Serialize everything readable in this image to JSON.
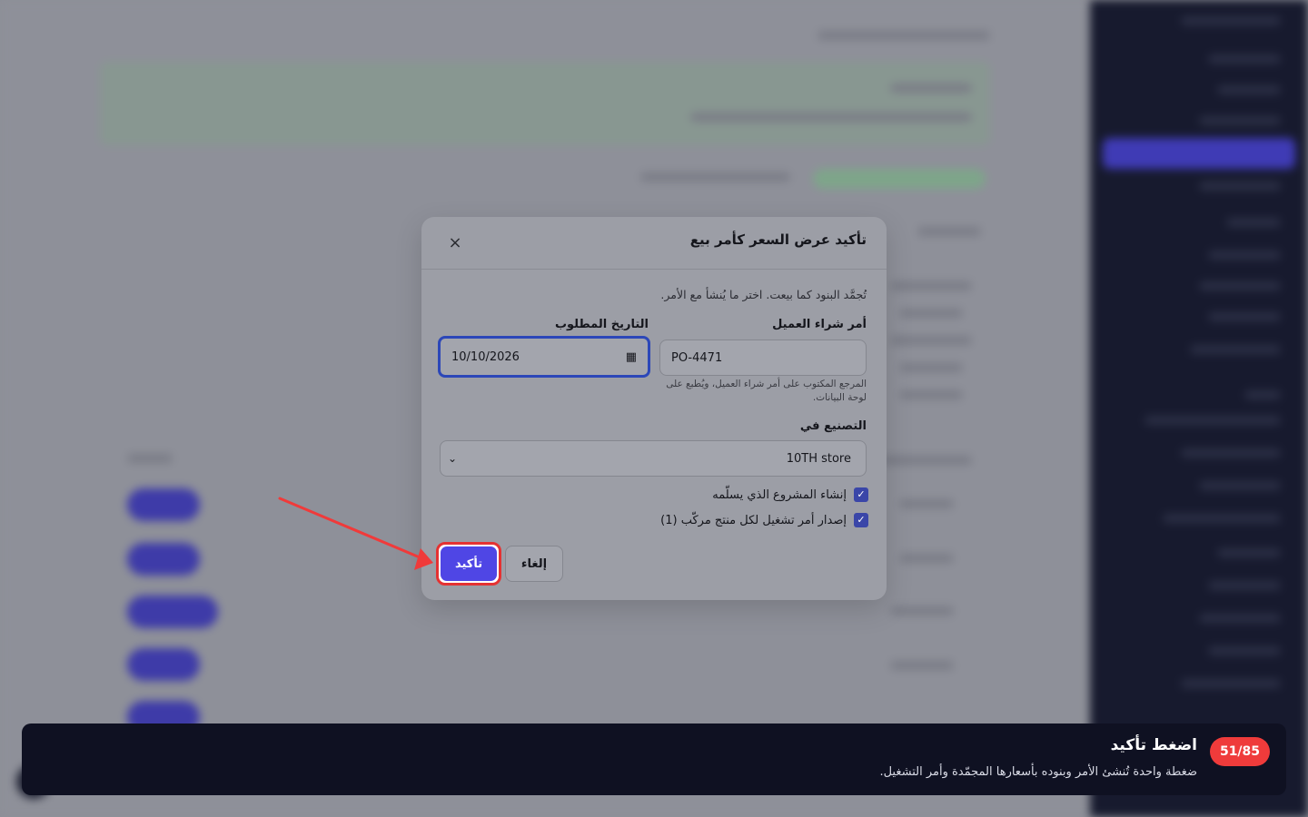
{
  "dialog": {
    "title": "تأكيد عرض السعر كأمر بيع",
    "intro": "تُجمَّد البنود كما بيعت. اختر ما يُنشأ مع الأمر.",
    "po_label": "أمر شراء العميل",
    "po_value": "PO-4471",
    "po_hint": "المرجع المكتوب على أمر شراء العميل، ويُطبع على لوحة البيانات.",
    "date_label": "التاريخ المطلوب",
    "date_value": "10/10/2026",
    "manufacture_label": "التصنيع في",
    "manufacture_value": "10TH store",
    "check_project": "إنشاء المشروع الذي يسلّمه",
    "check_work_order": "إصدار أمر تشغيل لكل منتج مركّب (1)",
    "cancel_label": "إلغاء",
    "confirm_label": "تأكيد",
    "close_glyph": "×"
  },
  "tour": {
    "step": "51/85",
    "title": "اضغط تأكيد",
    "description": "ضغطة واحدة تُنشئ الأمر وبنوده بأسعارها المجمّدة وأمر التشغيل."
  },
  "icons": {
    "close": "close-icon",
    "calendar": "calendar-icon",
    "chevron": "chevron-down-icon",
    "check": "check-icon"
  },
  "colors": {
    "accent": "#4f46e5",
    "highlight": "#e53232",
    "tour_bg": "#0f1122",
    "badge": "#ef3b3b"
  }
}
